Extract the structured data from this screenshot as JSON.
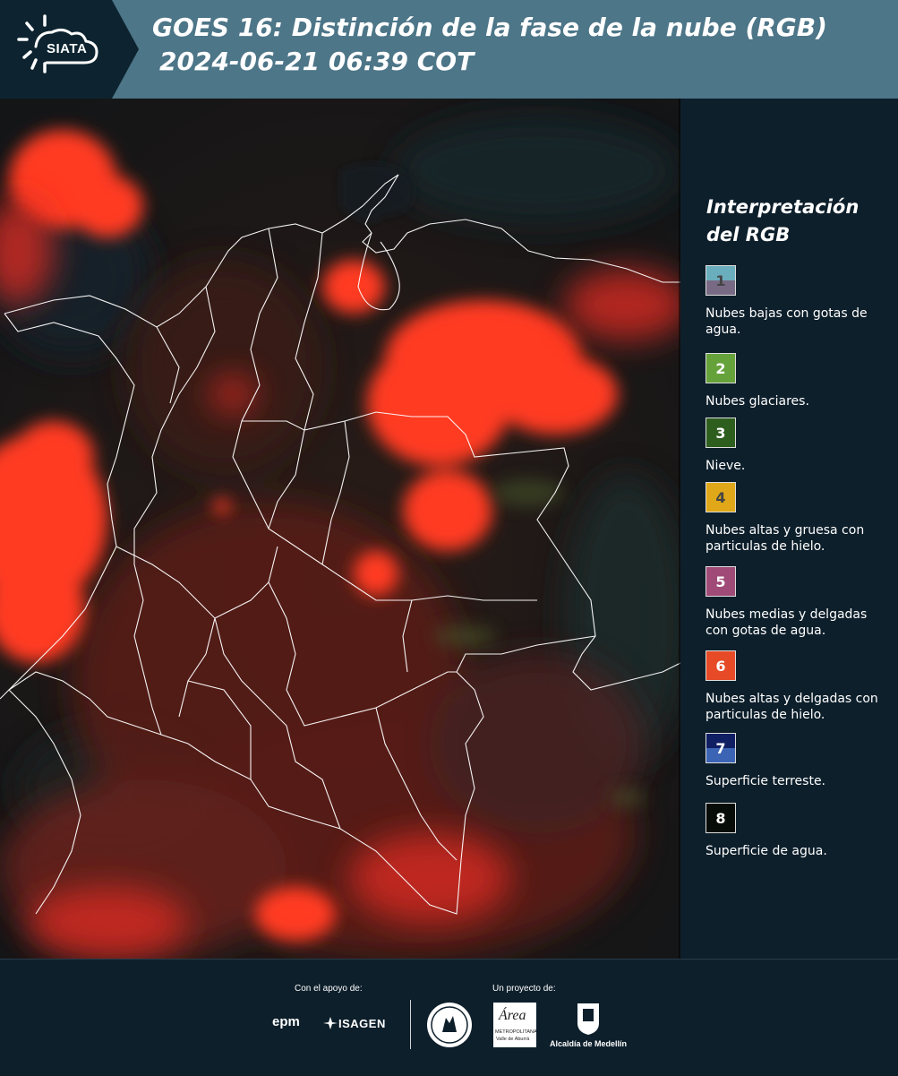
{
  "header": {
    "logo_text": "SIATA",
    "title_line1": "GOES 16: Distinción de la fase de la nube (RGB)",
    "title_line2": "2024-06-21 06:39 COT"
  },
  "legend": {
    "title": "Interpretación del RGB",
    "items": [
      {
        "num": "1",
        "label": "Nubes bajas con gotas de agua.",
        "color_top": "#6aaebe",
        "color_bottom": "#786a84",
        "num_color": "#444444"
      },
      {
        "num": "2",
        "label": "Nubes glaciares.",
        "color_top": "#66a23a",
        "color_bottom": "#66a23a",
        "num_color": "#ffffff"
      },
      {
        "num": "3",
        "label": "Nieve.",
        "color_top": "#2e5e1e",
        "color_bottom": "#2e5e1e",
        "num_color": "#ffffff"
      },
      {
        "num": "4",
        "label": "Nubes altas y gruesa con particulas de hielo.",
        "color_top": "#e0a818",
        "color_bottom": "#e0a818",
        "num_color": "#444444"
      },
      {
        "num": "5",
        "label": "Nubes medias y delgadas con gotas de agua.",
        "color_top": "#a04a78",
        "color_bottom": "#a04a78",
        "num_color": "#ffffff"
      },
      {
        "num": "6",
        "label": "Nubes altas y delgadas con particulas de hielo.",
        "color_top": "#e64a26",
        "color_bottom": "#e64a26",
        "num_color": "#ffffff"
      },
      {
        "num": "7",
        "label": "Superficie terreste.",
        "color_top": "#101e64",
        "color_bottom": "#3c64b4",
        "num_color": "#ffffff"
      },
      {
        "num": "8",
        "label": "Superficie de agua.",
        "color_top": "#080c08",
        "color_bottom": "#080c08",
        "num_color": "#ffffff"
      }
    ]
  },
  "footer": {
    "support_label": "Con el apoyo de:",
    "project_label": "Un proyecto de:",
    "sponsors": [
      "epm",
      "ISAGEN"
    ],
    "partner_area": "Área",
    "partner_area_sub": "METROPOLITANA",
    "partner_area_sub2": "Valle de Aburrá",
    "partner_alcaldia": "Alcaldía de Medellín"
  },
  "colors": {
    "header_bg": "#4d7688",
    "page_bg": "#0d1f2b",
    "cloud_red": "#ff3a22",
    "border_line": "#ffffff"
  }
}
